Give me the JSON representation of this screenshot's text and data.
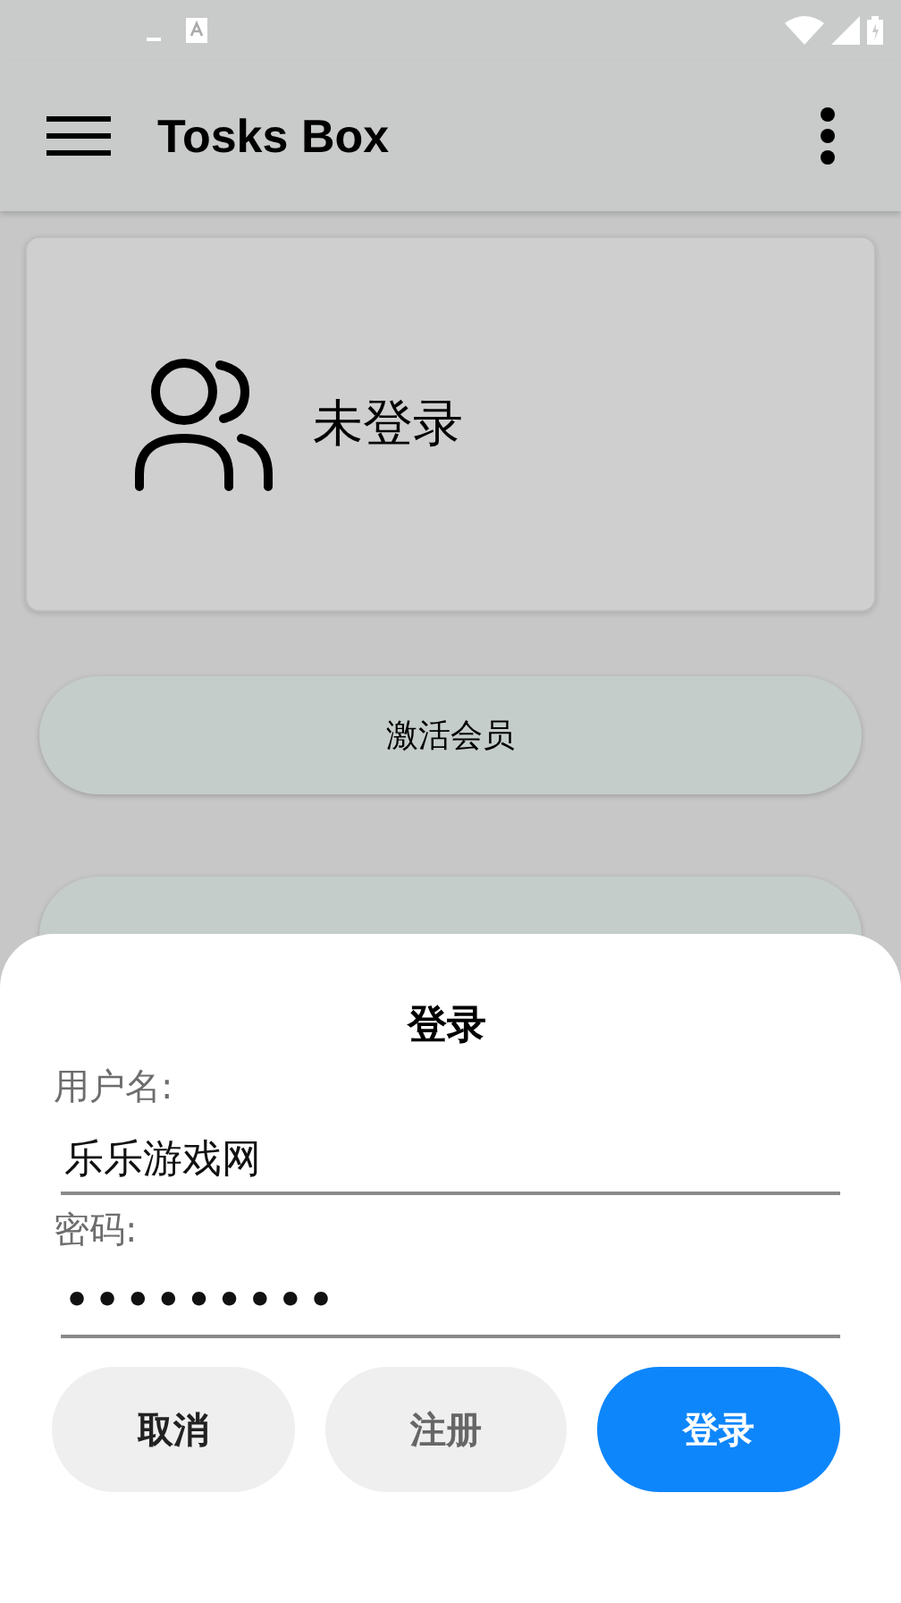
{
  "app_bar": {
    "title": "Tosks Box"
  },
  "profile_card": {
    "status": "未登录"
  },
  "menu_buttons": [
    {
      "label": "激活会员"
    }
  ],
  "login_sheet": {
    "title": "登录",
    "fields": [
      {
        "label": "用户名:",
        "value": "乐乐游戏网"
      },
      {
        "label": "密码:",
        "value": "•••••••••"
      }
    ],
    "buttons": [
      {
        "label": "取消",
        "kind": "cancel"
      },
      {
        "label": "注册",
        "kind": "secondary"
      },
      {
        "label": "登录",
        "kind": "primary"
      }
    ]
  }
}
